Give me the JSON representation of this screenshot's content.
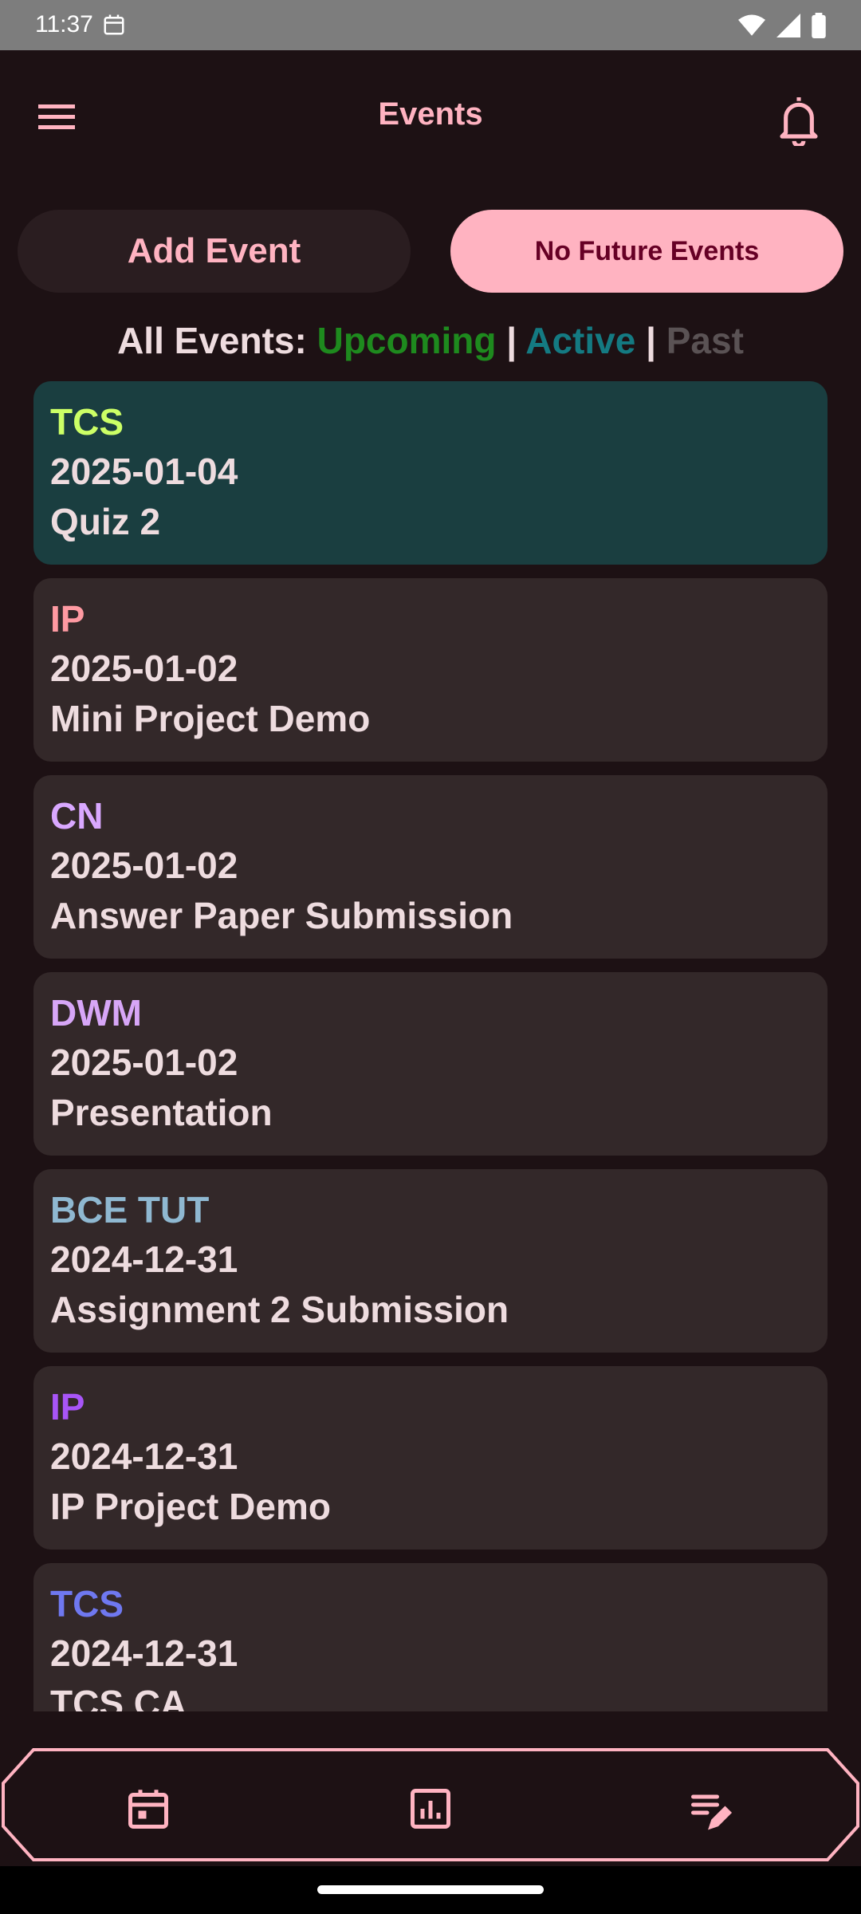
{
  "status_bar": {
    "time": "11:37",
    "icons": [
      "calendar-sync-icon",
      "wifi-icon",
      "cell-signal-icon",
      "battery-icon"
    ]
  },
  "app_bar": {
    "title": "Events",
    "menu_icon": "menu-icon",
    "notification_icon": "bell-icon"
  },
  "actions": {
    "add_event": "Add Event",
    "no_future_events": "No Future Events"
  },
  "filter": {
    "prefix": "All Events:",
    "upcoming": "Upcoming",
    "separator": "|",
    "active": "Active",
    "past": "Past"
  },
  "events": [
    {
      "tag": "TCS",
      "date": "2025-01-04",
      "name": "Quiz 2",
      "tag_color": "#ccff66",
      "highlight": true
    },
    {
      "tag": "IP",
      "date": "2025-01-02",
      "name": "Mini Project Demo",
      "tag_color": "#ff9aa2",
      "highlight": false
    },
    {
      "tag": "CN",
      "date": "2025-01-02",
      "name": "Answer Paper Submission",
      "tag_color": "#d9a8ff",
      "highlight": false
    },
    {
      "tag": "DWM",
      "date": "2025-01-02",
      "name": "Presentation",
      "tag_color": "#d7a6f7",
      "highlight": false
    },
    {
      "tag": "BCE TUT",
      "date": "2024-12-31",
      "name": "Assignment 2 Submission",
      "tag_color": "#8fb8d1",
      "highlight": false
    },
    {
      "tag": "IP",
      "date": "2024-12-31",
      "name": "IP Project Demo",
      "tag_color": "#a855f7",
      "highlight": false
    },
    {
      "tag": "TCS",
      "date": "2024-12-31",
      "name": "TCS CA",
      "tag_color": "#6f78f0",
      "highlight": false
    }
  ],
  "bottom_nav": [
    {
      "icon": "calendar-icon"
    },
    {
      "icon": "chart-icon"
    },
    {
      "icon": "edit-notes-icon"
    }
  ],
  "colors": {
    "background": "#1d1114",
    "accent": "#ffb3c1",
    "card": "#332829",
    "card_highlight": "#1a3e40",
    "upcoming": "#1e8a1e",
    "active": "#147a82",
    "past": "#5a5254"
  }
}
